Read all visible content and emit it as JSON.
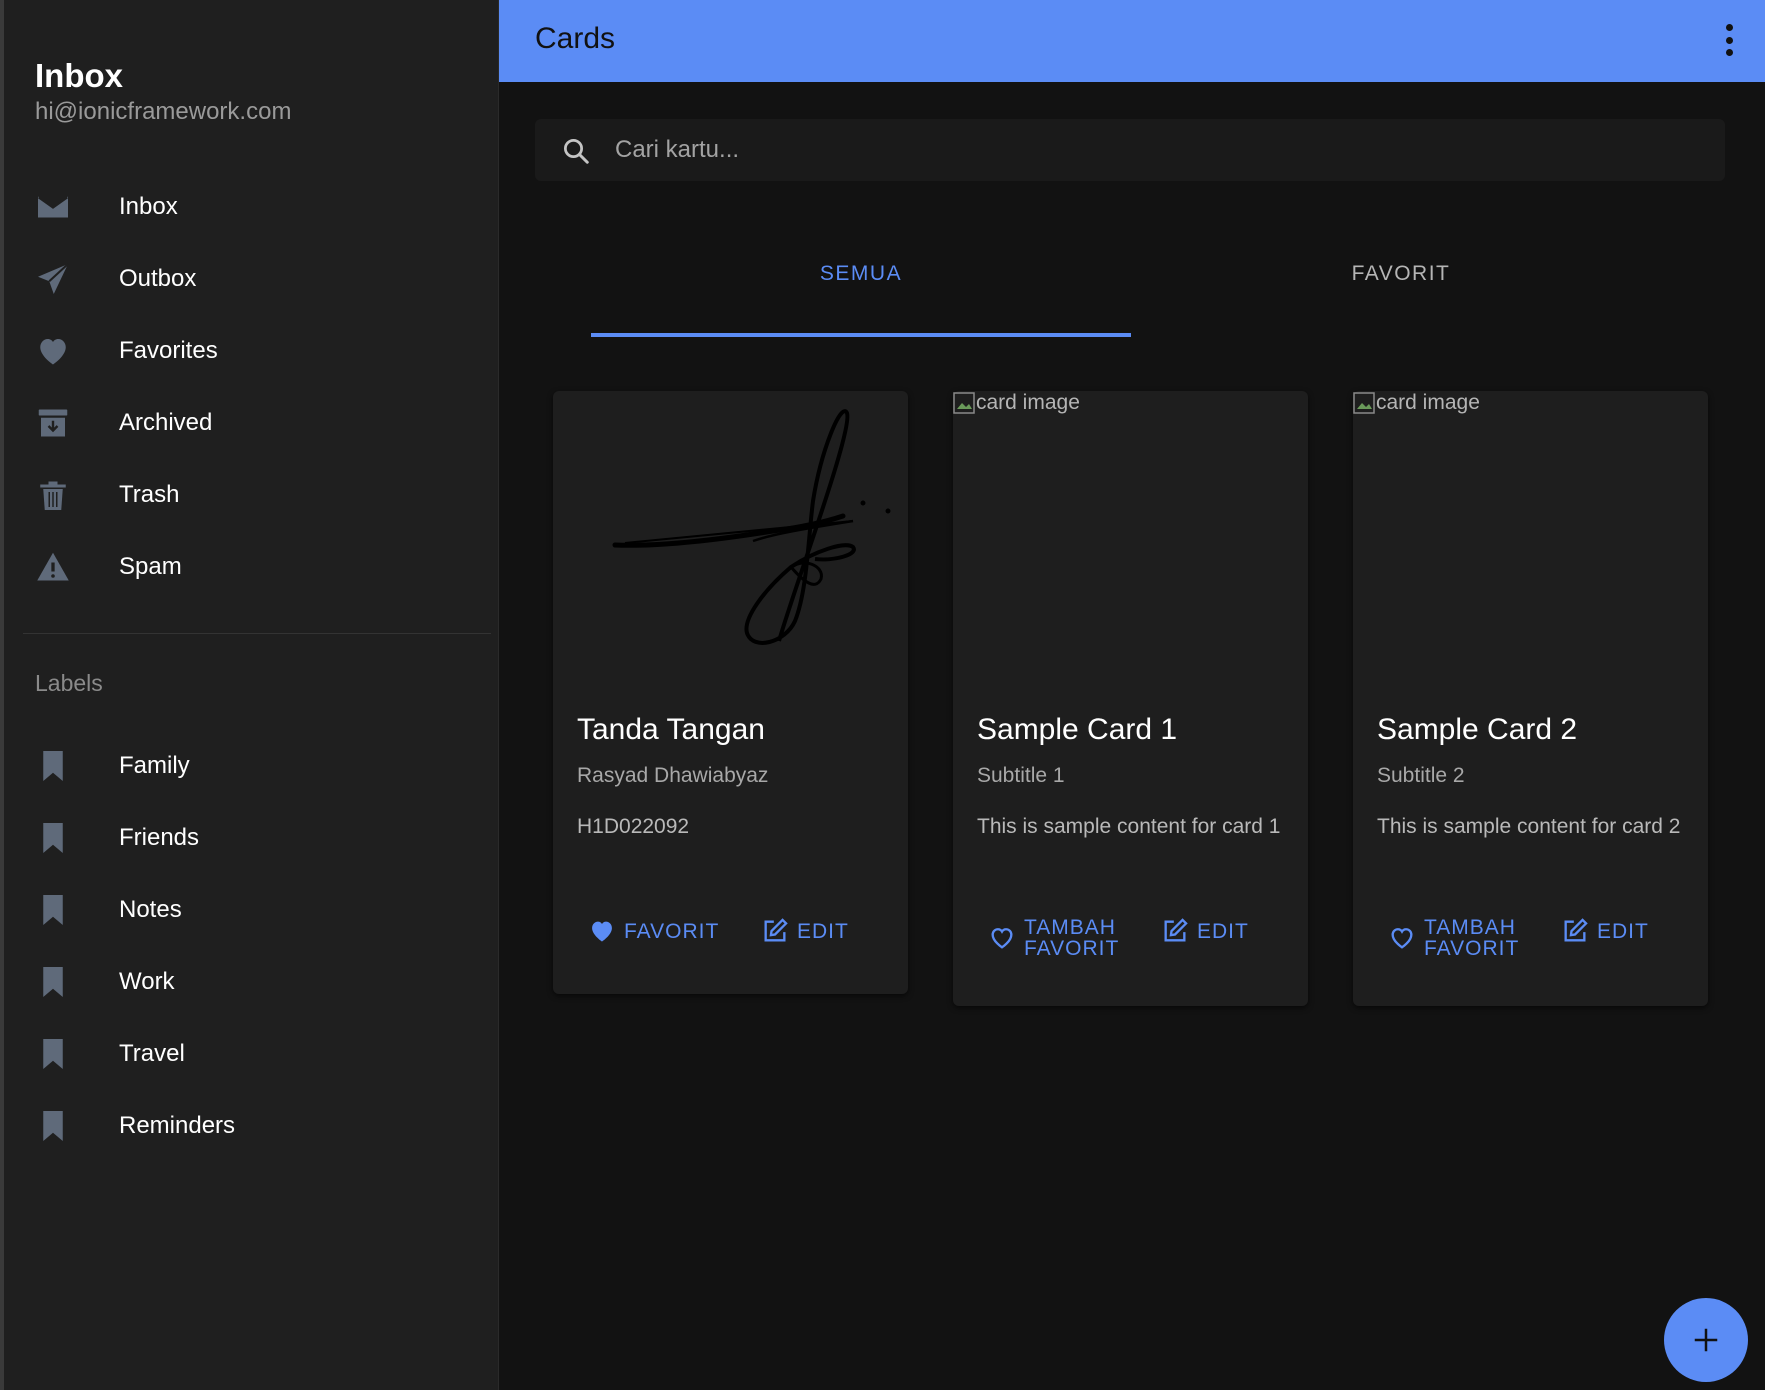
{
  "sidebar": {
    "title": "Inbox",
    "email": "hi@ionicframework.com",
    "items": [
      {
        "label": "Inbox",
        "icon": "mail-icon"
      },
      {
        "label": "Outbox",
        "icon": "paper-plane-icon"
      },
      {
        "label": "Favorites",
        "icon": "heart-icon"
      },
      {
        "label": "Archived",
        "icon": "archive-icon"
      },
      {
        "label": "Trash",
        "icon": "trash-icon"
      },
      {
        "label": "Spam",
        "icon": "warning-icon"
      }
    ],
    "labels_heading": "Labels",
    "labels": [
      {
        "label": "Family",
        "icon": "bookmark-icon"
      },
      {
        "label": "Friends",
        "icon": "bookmark-icon"
      },
      {
        "label": "Notes",
        "icon": "bookmark-icon"
      },
      {
        "label": "Work",
        "icon": "bookmark-icon"
      },
      {
        "label": "Travel",
        "icon": "bookmark-icon"
      },
      {
        "label": "Reminders",
        "icon": "bookmark-icon"
      }
    ]
  },
  "toolbar": {
    "title": "Cards",
    "menu_icon": "ellipsis-vertical-icon"
  },
  "search": {
    "placeholder": "Cari kartu...",
    "value": ""
  },
  "tabs": [
    {
      "label": "SEMUA",
      "active": true
    },
    {
      "label": "FAVORIT",
      "active": false
    }
  ],
  "cards": [
    {
      "image": "signature",
      "title": "Tanda Tangan",
      "subtitle": "Rasyad Dhawiabyaz",
      "content": "H1D022092",
      "favorite_label": "FAVORIT",
      "favorite_line2": "",
      "is_favorite": true,
      "edit_label": "EDIT"
    },
    {
      "image_alt": "card image",
      "title": "Sample Card 1",
      "subtitle": "Subtitle 1",
      "content": "This is sample content for card 1",
      "favorite_label": "TAMBAH",
      "favorite_line2": "FAVORIT",
      "is_favorite": false,
      "edit_label": "EDIT"
    },
    {
      "image_alt": "card image",
      "title": "Sample Card 2",
      "subtitle": "Subtitle 2",
      "content": "This is sample content for card 2",
      "favorite_label": "TAMBAH",
      "favorite_line2": "FAVORIT",
      "is_favorite": false,
      "edit_label": "EDIT"
    }
  ],
  "fab": {
    "icon": "add-icon"
  },
  "colors": {
    "accent": "#5b8cf5",
    "background": "#121212",
    "sidebar": "#1f1f1f",
    "card": "#1e1e1e",
    "icon_muted": "#5f6a7a"
  }
}
